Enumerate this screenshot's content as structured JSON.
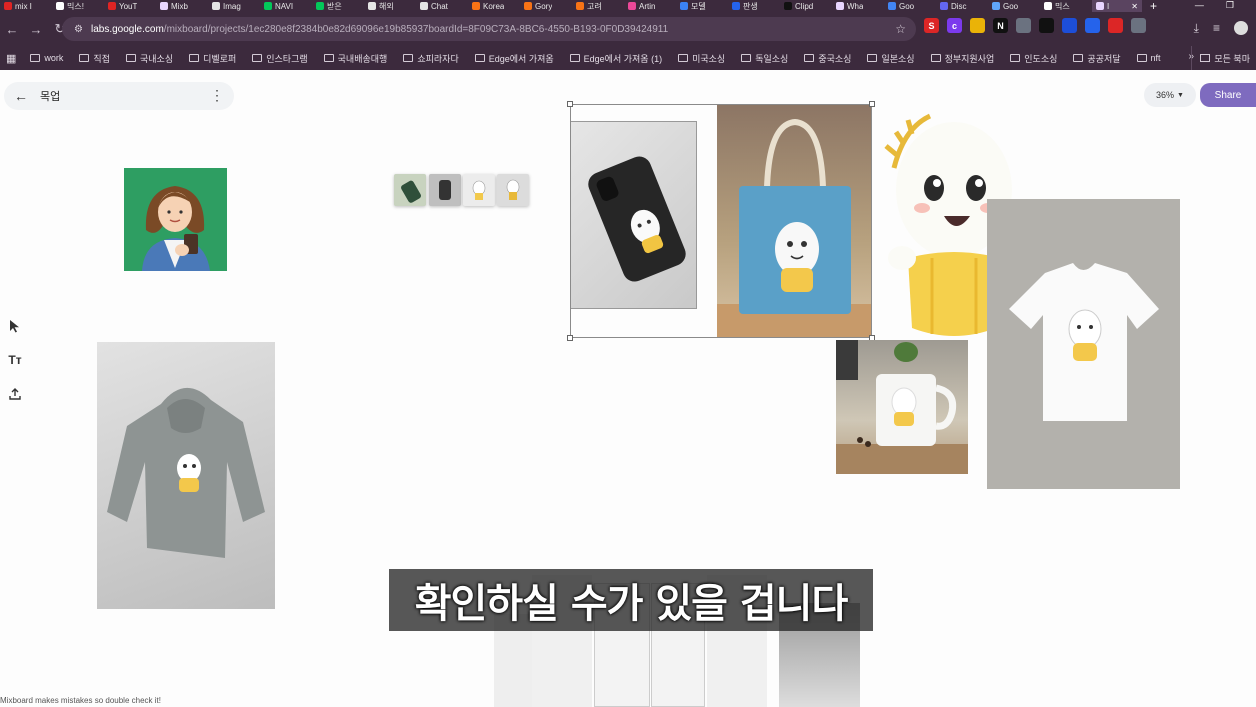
{
  "browser": {
    "tabs": [
      {
        "title": "mix I",
        "color": "#e02424"
      },
      {
        "title": "믹스!",
        "color": "#ffffff"
      },
      {
        "title": "YouT",
        "color": "#e02424"
      },
      {
        "title": "Mixb",
        "color": "#e9d5ff"
      },
      {
        "title": "Imag",
        "color": "#e5e5e5"
      },
      {
        "title": "NAVI",
        "color": "#03c75a"
      },
      {
        "title": "받은",
        "color": "#03c75a"
      },
      {
        "title": "해외",
        "color": "#e5e5e5"
      },
      {
        "title": "Chat",
        "color": "#e5e5e5"
      },
      {
        "title": "Korea",
        "color": "#f97316"
      },
      {
        "title": "Gory",
        "color": "#f97316"
      },
      {
        "title": "고려",
        "color": "#f97316"
      },
      {
        "title": "Artin",
        "color": "#ec4899"
      },
      {
        "title": "모델",
        "color": "#3b82f6"
      },
      {
        "title": "판생",
        "color": "#2563eb"
      },
      {
        "title": "Clipd",
        "color": "#111111"
      },
      {
        "title": "Wha",
        "color": "#e9d5ff"
      },
      {
        "title": "Goo",
        "color": "#4285f4"
      },
      {
        "title": "Disc",
        "color": "#6366f1"
      },
      {
        "title": "Goo",
        "color": "#60a5fa"
      },
      {
        "title": "믹스",
        "color": "#ffffff"
      },
      {
        "title": "I",
        "color": "#e9d5ff"
      }
    ],
    "new_tab": "+",
    "url_host": "labs.google.com",
    "url_path": "/mixboard/projects/1ec280e8f2384b0e82d69096e19b85937boardId=8F09C73A-8BC6-4550-B193-0F0D39424911",
    "extensions": [
      {
        "letter": "S",
        "color": "#dc2626"
      },
      {
        "letter": "c",
        "color": "#7c3aed"
      },
      {
        "letter": "",
        "color": "#eab308"
      },
      {
        "letter": "N",
        "color": "#111111"
      },
      {
        "letter": "",
        "color": "#6b7280"
      },
      {
        "letter": "",
        "color": "#111111"
      },
      {
        "letter": "",
        "color": "#1d4ed8"
      },
      {
        "letter": "",
        "color": "#2563eb"
      },
      {
        "letter": "",
        "color": "#dc2626"
      },
      {
        "letter": "",
        "color": "#6b7280"
      }
    ],
    "bookmarks": [
      "work",
      "직접",
      "국내소싱",
      "디벨로퍼",
      "인스타그램",
      "국내배송대행",
      "쇼피라자다",
      "Edge에서 가져옴",
      "Edge에서 가져옴 (1)",
      "미국소싱",
      "독일소싱",
      "중국소싱",
      "일본소싱",
      "정부지원사업",
      "인도소싱",
      "공공저달",
      "nft"
    ],
    "bookmarks_more": "»",
    "all_bookmarks": "모든 북마"
  },
  "app": {
    "project_name": "목업",
    "zoom": "36%",
    "share_label": "Share",
    "tools": [
      "select-tool",
      "text-tool",
      "upload-tool"
    ],
    "text_tool_label": "Tт",
    "disclaimer": "Mixboard makes mistakes so double check it!"
  },
  "colors": {
    "accent": "#7e6bbf",
    "chrome": "#3c2a3d"
  },
  "subtitle": "확인하실 수가 있을 겁니다"
}
